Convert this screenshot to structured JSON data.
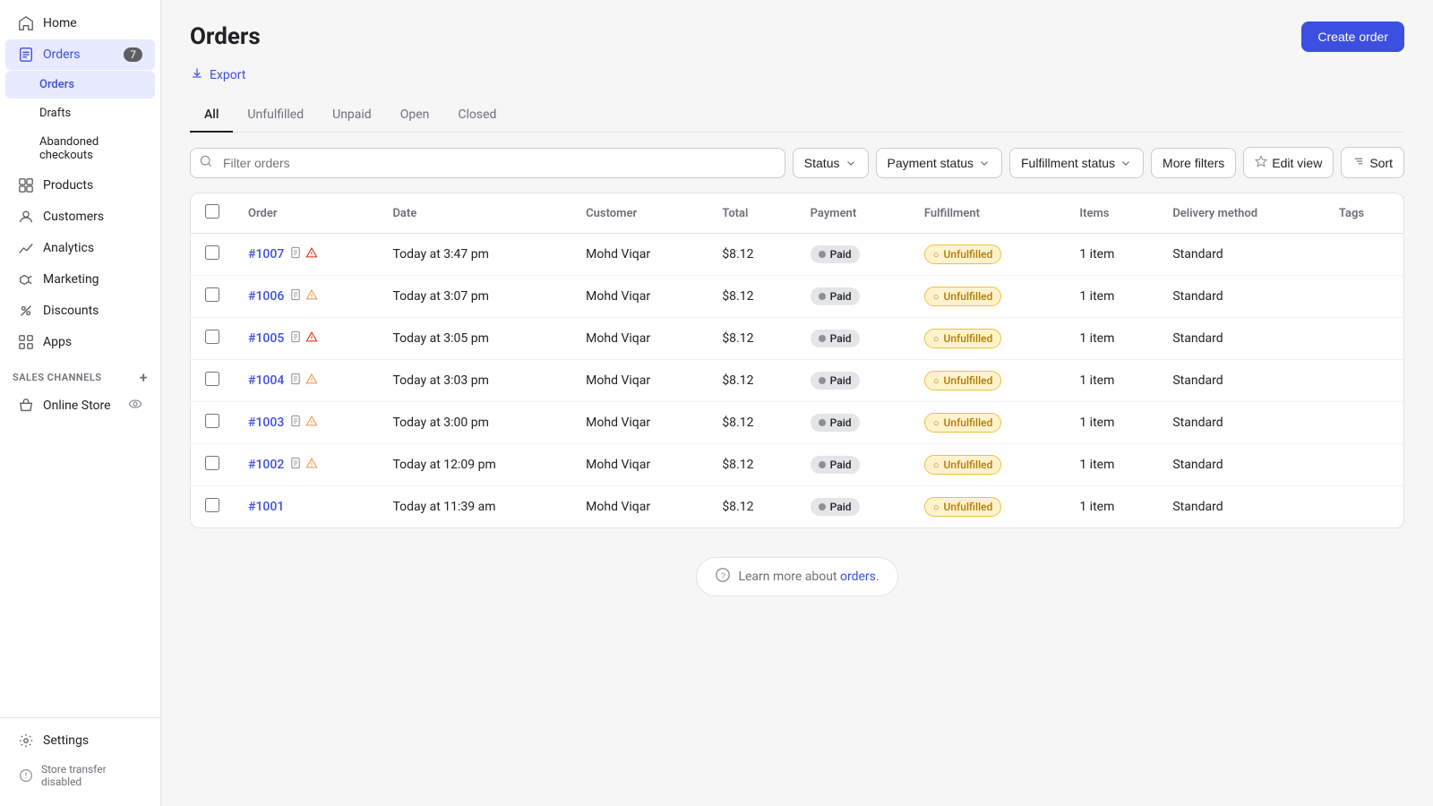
{
  "sidebar": {
    "nav_items": [
      {
        "id": "home",
        "label": "Home",
        "icon": "home-icon",
        "active": false
      },
      {
        "id": "orders",
        "label": "Orders",
        "icon": "orders-icon",
        "active": true,
        "badge": "7"
      },
      {
        "id": "products",
        "label": "Products",
        "icon": "products-icon",
        "active": false
      },
      {
        "id": "customers",
        "label": "Customers",
        "icon": "customers-icon",
        "active": false
      },
      {
        "id": "analytics",
        "label": "Analytics",
        "icon": "analytics-icon",
        "active": false
      },
      {
        "id": "marketing",
        "label": "Marketing",
        "icon": "marketing-icon",
        "active": false
      },
      {
        "id": "discounts",
        "label": "Discounts",
        "icon": "discounts-icon",
        "active": false
      },
      {
        "id": "apps",
        "label": "Apps",
        "icon": "apps-icon",
        "active": false
      }
    ],
    "orders_sub": [
      {
        "id": "orders-sub",
        "label": "Orders",
        "active": true
      },
      {
        "id": "drafts",
        "label": "Drafts",
        "active": false
      },
      {
        "id": "abandoned-checkouts",
        "label": "Abandoned checkouts",
        "active": false
      }
    ],
    "sales_channels_label": "SALES CHANNELS",
    "online_store_label": "Online Store",
    "settings_label": "Settings",
    "store_transfer_label": "Store transfer disabled"
  },
  "page": {
    "title": "Orders",
    "create_order_btn": "Create order",
    "export_label": "Export"
  },
  "tabs": [
    {
      "id": "all",
      "label": "All",
      "active": true
    },
    {
      "id": "unfulfilled",
      "label": "Unfulfilled",
      "active": false
    },
    {
      "id": "unpaid",
      "label": "Unpaid",
      "active": false
    },
    {
      "id": "open",
      "label": "Open",
      "active": false
    },
    {
      "id": "closed",
      "label": "Closed",
      "active": false
    }
  ],
  "filters": {
    "search_placeholder": "Filter orders",
    "status_label": "Status",
    "payment_status_label": "Payment status",
    "fulfillment_status_label": "Fulfillment status",
    "more_filters_label": "More filters",
    "edit_view_label": "Edit view",
    "sort_label": "Sort"
  },
  "table": {
    "columns": [
      {
        "id": "order",
        "label": "Order"
      },
      {
        "id": "date",
        "label": "Date"
      },
      {
        "id": "customer",
        "label": "Customer"
      },
      {
        "id": "total",
        "label": "Total"
      },
      {
        "id": "payment",
        "label": "Payment"
      },
      {
        "id": "fulfillment",
        "label": "Fulfillment"
      },
      {
        "id": "items",
        "label": "Items"
      },
      {
        "id": "delivery",
        "label": "Delivery method"
      },
      {
        "id": "tags",
        "label": "Tags"
      }
    ],
    "rows": [
      {
        "id": "#1007",
        "date": "Today at 3:47 pm",
        "customer": "Mohd Viqar",
        "total": "$8.12",
        "payment": "Paid",
        "fulfillment": "Unfulfilled",
        "items": "1 item",
        "delivery": "Standard",
        "has_doc": true,
        "has_warn": true,
        "warn_red": true
      },
      {
        "id": "#1006",
        "date": "Today at 3:07 pm",
        "customer": "Mohd Viqar",
        "total": "$8.12",
        "payment": "Paid",
        "fulfillment": "Unfulfilled",
        "items": "1 item",
        "delivery": "Standard",
        "has_doc": true,
        "has_warn": true,
        "warn_red": false
      },
      {
        "id": "#1005",
        "date": "Today at 3:05 pm",
        "customer": "Mohd Viqar",
        "total": "$8.12",
        "payment": "Paid",
        "fulfillment": "Unfulfilled",
        "items": "1 item",
        "delivery": "Standard",
        "has_doc": true,
        "has_warn": true,
        "warn_red": true
      },
      {
        "id": "#1004",
        "date": "Today at 3:03 pm",
        "customer": "Mohd Viqar",
        "total": "$8.12",
        "payment": "Paid",
        "fulfillment": "Unfulfilled",
        "items": "1 item",
        "delivery": "Standard",
        "has_doc": true,
        "has_warn": true,
        "warn_red": false
      },
      {
        "id": "#1003",
        "date": "Today at 3:00 pm",
        "customer": "Mohd Viqar",
        "total": "$8.12",
        "payment": "Paid",
        "fulfillment": "Unfulfilled",
        "items": "1 item",
        "delivery": "Standard",
        "has_doc": true,
        "has_warn": true,
        "warn_red": false
      },
      {
        "id": "#1002",
        "date": "Today at 12:09 pm",
        "customer": "Mohd Viqar",
        "total": "$8.12",
        "payment": "Paid",
        "fulfillment": "Unfulfilled",
        "items": "1 item",
        "delivery": "Standard",
        "has_doc": true,
        "has_warn": true,
        "warn_red": false
      },
      {
        "id": "#1001",
        "date": "Today at 11:39 am",
        "customer": "Mohd Viqar",
        "total": "$8.12",
        "payment": "Paid",
        "fulfillment": "Unfulfilled",
        "items": "1 item",
        "delivery": "Standard",
        "has_doc": false,
        "has_warn": false,
        "warn_red": false
      }
    ]
  },
  "learn_more": {
    "text": "Learn more about ",
    "link_text": "orders.",
    "link_href": "#"
  }
}
